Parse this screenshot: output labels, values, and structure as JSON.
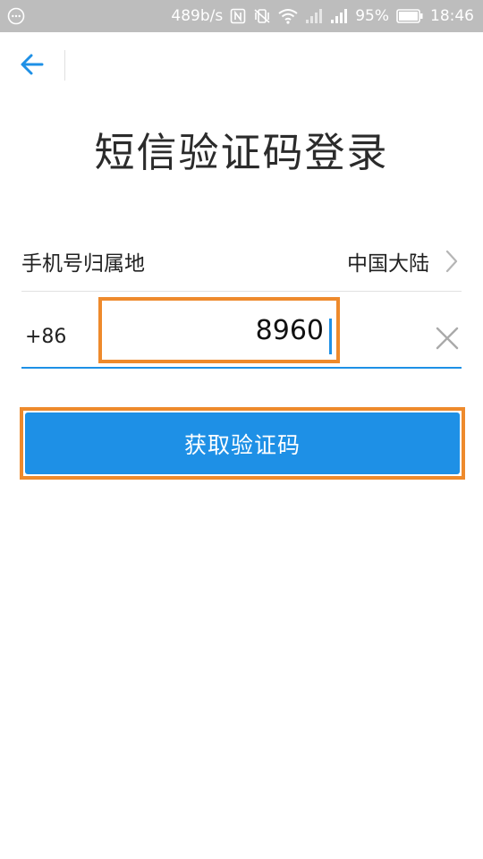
{
  "status_bar": {
    "net_speed": "489b/s",
    "battery": "95%",
    "time": "18:46",
    "icons": [
      "notification-dots-icon",
      "nfc-icon",
      "vibrate-icon",
      "wifi-icon",
      "signal-weak-icon",
      "signal-icon",
      "battery-icon"
    ]
  },
  "header": {
    "back_icon": "arrow-left-icon"
  },
  "page": {
    "title": "短信验证码登录"
  },
  "region": {
    "label": "手机号归属地",
    "value": "中国大陆"
  },
  "phone": {
    "country_code": "+86",
    "value": "8960"
  },
  "actions": {
    "get_code_label": "获取验证码"
  },
  "colors": {
    "accent": "#1e90e6",
    "highlight": "#ee8a2c",
    "status_bar": "#bdbdbd"
  }
}
